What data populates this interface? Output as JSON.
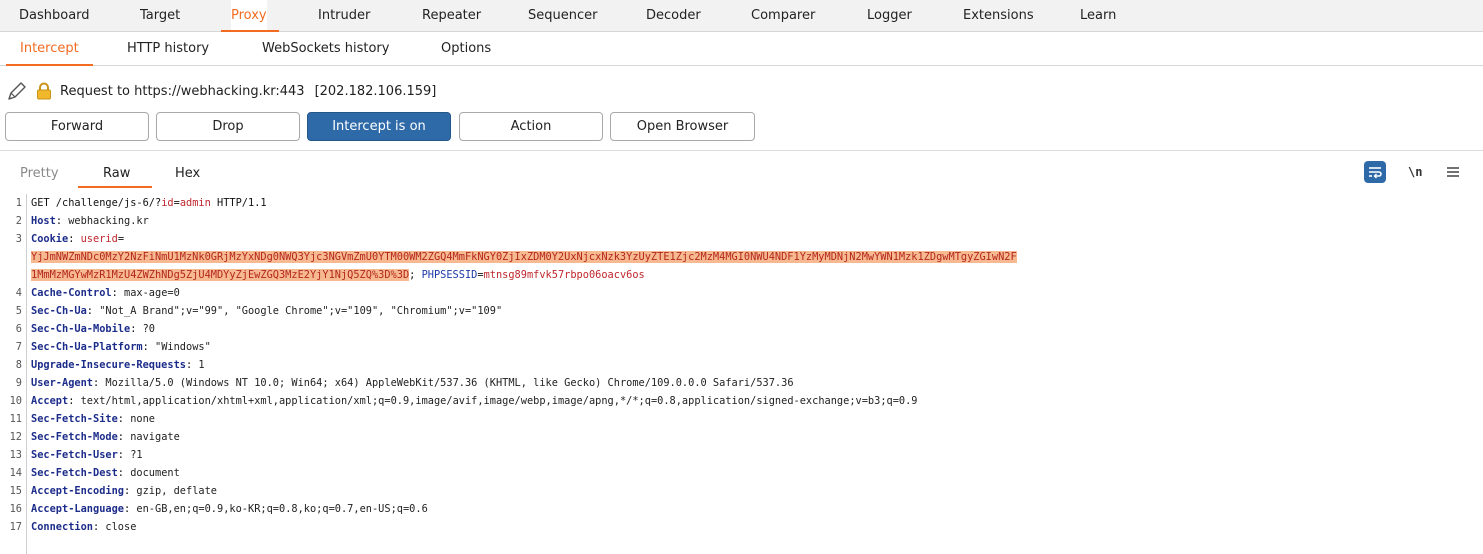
{
  "main_tabs": [
    "Dashboard",
    "Target",
    "Proxy",
    "Intruder",
    "Repeater",
    "Sequencer",
    "Decoder",
    "Comparer",
    "Logger",
    "Extensions",
    "Learn"
  ],
  "sub_tabs": [
    "Intercept",
    "HTTP history",
    "WebSockets history",
    "Options"
  ],
  "request_info": {
    "label": "Request to https://webhacking.kr:443",
    "ip": "[202.182.106.159]"
  },
  "buttons": {
    "forward": "Forward",
    "drop": "Drop",
    "intercept": "Intercept is on",
    "action": "Action",
    "open_browser": "Open Browser"
  },
  "editor_tabs": [
    "Pretty",
    "Raw",
    "Hex"
  ],
  "toolbar": {
    "newline_label": "\\n"
  },
  "request": {
    "line1": {
      "method": "GET",
      "path_pre": " /challenge/js-6/?",
      "param_name": "id",
      "eq": "=",
      "param_value": "admin",
      "proto": " HTTP/1.1"
    },
    "host": {
      "name": "Host",
      "value": "webhacking.kr"
    },
    "cookie": {
      "name": "Cookie",
      "userid_name": "userid",
      "userid_value_part1": "YjJmNWZmNDc0MzY2NzFiNmU1MzNk0GRjMzYxNDg0NWQ3Yjc3NGVmZmU0YTM00WM2ZGQ4MmFkNGY0ZjIxZDM0Y2UxNjcxNzk3YzUyZTE1Zjc2MzM4MGI0NWU4NDF1YzMyMDNjN2MwYWN1Mzk1ZDgwMTgyZGIwN2F",
      "userid_value_part2": "1MmMzMGYwMzR1MzU4ZWZhNDg5ZjU4MDYyZjEwZGQ3MzE2YjY1NjQ5ZQ%3D%3D",
      "sess_name": "PHPSESSID",
      "sess_value": "mtnsg89mfvk57rbpo06oacv6os"
    },
    "headers": [
      {
        "name": "Cache-Control",
        "value": "max-age=0"
      },
      {
        "name": "Sec-Ch-Ua",
        "value": "\"Not_A Brand\";v=\"99\", \"Google Chrome\";v=\"109\", \"Chromium\";v=\"109\""
      },
      {
        "name": "Sec-Ch-Ua-Mobile",
        "value": "?0"
      },
      {
        "name": "Sec-Ch-Ua-Platform",
        "value": "\"Windows\""
      },
      {
        "name": "Upgrade-Insecure-Requests",
        "value": "1"
      },
      {
        "name": "User-Agent",
        "value": "Mozilla/5.0 (Windows NT 10.0; Win64; x64) AppleWebKit/537.36 (KHTML, like Gecko) Chrome/109.0.0.0 Safari/537.36"
      },
      {
        "name": "Accept",
        "value": "text/html,application/xhtml+xml,application/xml;q=0.9,image/avif,image/webp,image/apng,*/*;q=0.8,application/signed-exchange;v=b3;q=0.9"
      },
      {
        "name": "Sec-Fetch-Site",
        "value": "none"
      },
      {
        "name": "Sec-Fetch-Mode",
        "value": "navigate"
      },
      {
        "name": "Sec-Fetch-User",
        "value": "?1"
      },
      {
        "name": "Sec-Fetch-Dest",
        "value": "document"
      },
      {
        "name": "Accept-Encoding",
        "value": "gzip, deflate"
      },
      {
        "name": "Accept-Language",
        "value": "en-GB,en;q=0.9,ko-KR;q=0.8,ko;q=0.7,en-US;q=0.6"
      },
      {
        "name": "Connection",
        "value": "close"
      }
    ],
    "line_numbers": [
      "1",
      "2",
      "3",
      "4",
      "5",
      "6",
      "7",
      "8",
      "9",
      "10",
      "11",
      "12",
      "13",
      "14",
      "15",
      "16",
      "17"
    ]
  },
  "colors": {
    "accent": "#f26b21",
    "primary_button": "#2e6aa8",
    "highlight": "#f7b98f",
    "header_name": "#1c2c8a",
    "param_red": "#c0262d"
  },
  "icons": [
    "pencil-icon",
    "lock-icon",
    "word-wrap-icon",
    "newline-toggle-icon",
    "menu-icon"
  ]
}
